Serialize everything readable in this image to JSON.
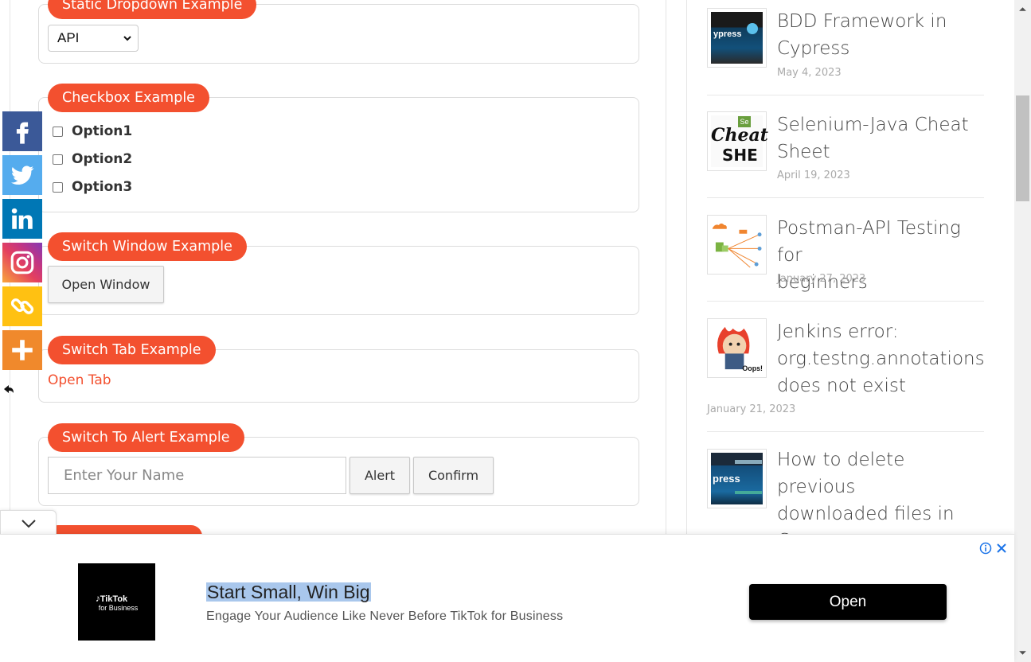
{
  "sections": {
    "dropdown": {
      "legend": "Static Dropdown Example",
      "selected": "API"
    },
    "checkbox": {
      "legend": "Checkbox Example",
      "options": [
        "Option1",
        "Option2",
        "Option3"
      ]
    },
    "switch_window": {
      "legend": "Switch Window Example",
      "button": "Open Window"
    },
    "switch_tab": {
      "legend": "Switch Tab Example",
      "link": "Open Tab"
    },
    "alert": {
      "legend": "Switch To Alert Example",
      "placeholder": "Enter Your Name",
      "alert_button": "Alert",
      "confirm_button": "Confirm"
    }
  },
  "share_bar": {
    "items": [
      {
        "name": "facebook",
        "icon": "facebook-icon",
        "color": "#3b5998"
      },
      {
        "name": "twitter",
        "icon": "twitter-icon",
        "color": "#55acee"
      },
      {
        "name": "linkedin",
        "icon": "linkedin-icon",
        "color": "#0077b5"
      },
      {
        "name": "instagram",
        "icon": "instagram-icon",
        "color": "#c13584"
      },
      {
        "name": "copy-link",
        "icon": "link-icon",
        "color": "#ffc112"
      },
      {
        "name": "more",
        "icon": "plus-icon",
        "color": "#f0892c"
      }
    ]
  },
  "sidebar": {
    "posts": [
      {
        "title_lines": [
          "BDD Framework in",
          "Cypress"
        ],
        "date": "May 4, 2023"
      },
      {
        "title_lines": [
          "Selenium-Java Cheat",
          "Sheet"
        ],
        "date": "April 19, 2023"
      },
      {
        "title_lines": [
          "Postman-API Testing for",
          "beginners"
        ],
        "date": "January 27, 2023"
      },
      {
        "title_lines": [
          "Jenkins error:",
          "org.testng.annotations",
          "does not exist"
        ],
        "date": "January 21, 2023"
      },
      {
        "title_lines": [
          "How to delete previous",
          "downloaded files in",
          "Cypress"
        ],
        "date": ""
      }
    ]
  },
  "ad": {
    "logo_text_1": "TikTok",
    "logo_text_2": "for Business",
    "headline": "Start Small, Win Big",
    "description": "Engage Your Audience Like Never Before TikTok for Business",
    "cta": "Open"
  },
  "colors": {
    "accent": "#f3502f"
  }
}
